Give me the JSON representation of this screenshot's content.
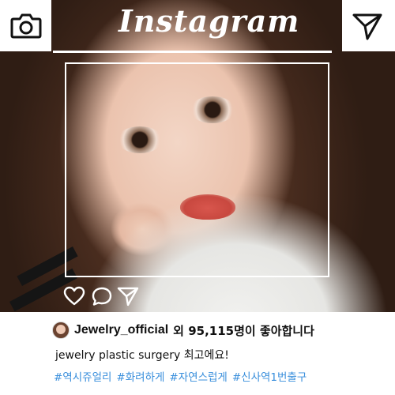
{
  "header": {
    "logo_text": "Instagram",
    "camera_icon": "camera-icon",
    "direct_icon": "paper-plane-icon"
  },
  "actions": {
    "like_icon": "heart-icon",
    "comment_icon": "comment-icon",
    "share_icon": "paper-plane-icon"
  },
  "post": {
    "username": "Jewelry_official",
    "likes_text": "외 95,115명이 좋아합니다",
    "caption": "jewelry plastic surgery 최고에요!",
    "hashtags": [
      "#역시쥬얼리",
      "#화려하게",
      "#자연스럽게",
      "#신사역1번출구"
    ]
  },
  "colors": {
    "hashtag": "#3a8fdc",
    "text": "#111111",
    "frame": "#ffffff"
  }
}
